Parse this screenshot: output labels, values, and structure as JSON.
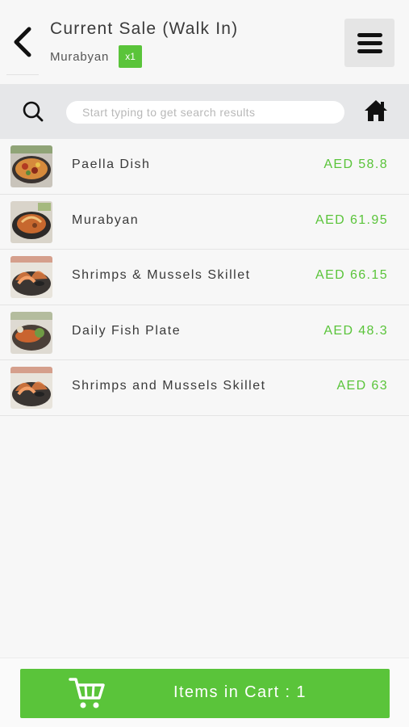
{
  "header": {
    "title": "Current Sale (Walk In)",
    "customer": "Murabyan",
    "qty_badge": "x1",
    "back_icon": "chevron-left-icon",
    "menu_icon": "hamburger-menu-icon"
  },
  "search": {
    "placeholder": "Start typing to get search results",
    "search_icon": "magnifier-icon",
    "home_icon": "home-icon"
  },
  "items": [
    {
      "name": "Paella Dish",
      "price": "AED 58.8",
      "thumb": "paella"
    },
    {
      "name": "Murabyan",
      "price": "AED 61.95",
      "thumb": "murabyan"
    },
    {
      "name": "Shrimps & Mussels Skillet",
      "price": "AED 66.15",
      "thumb": "skillet"
    },
    {
      "name": "Daily Fish Plate",
      "price": "AED 48.3",
      "thumb": "fish"
    },
    {
      "name": "Shrimps and Mussels Skillet",
      "price": "AED 63",
      "thumb": "skillet"
    }
  ],
  "cart": {
    "label": "Items in Cart : 1",
    "icon": "shopping-cart-icon"
  },
  "colors": {
    "accent_green": "#5ac43a",
    "search_bar_bg": "#e6e7e9",
    "menu_button_bg": "#e5e5e5"
  }
}
